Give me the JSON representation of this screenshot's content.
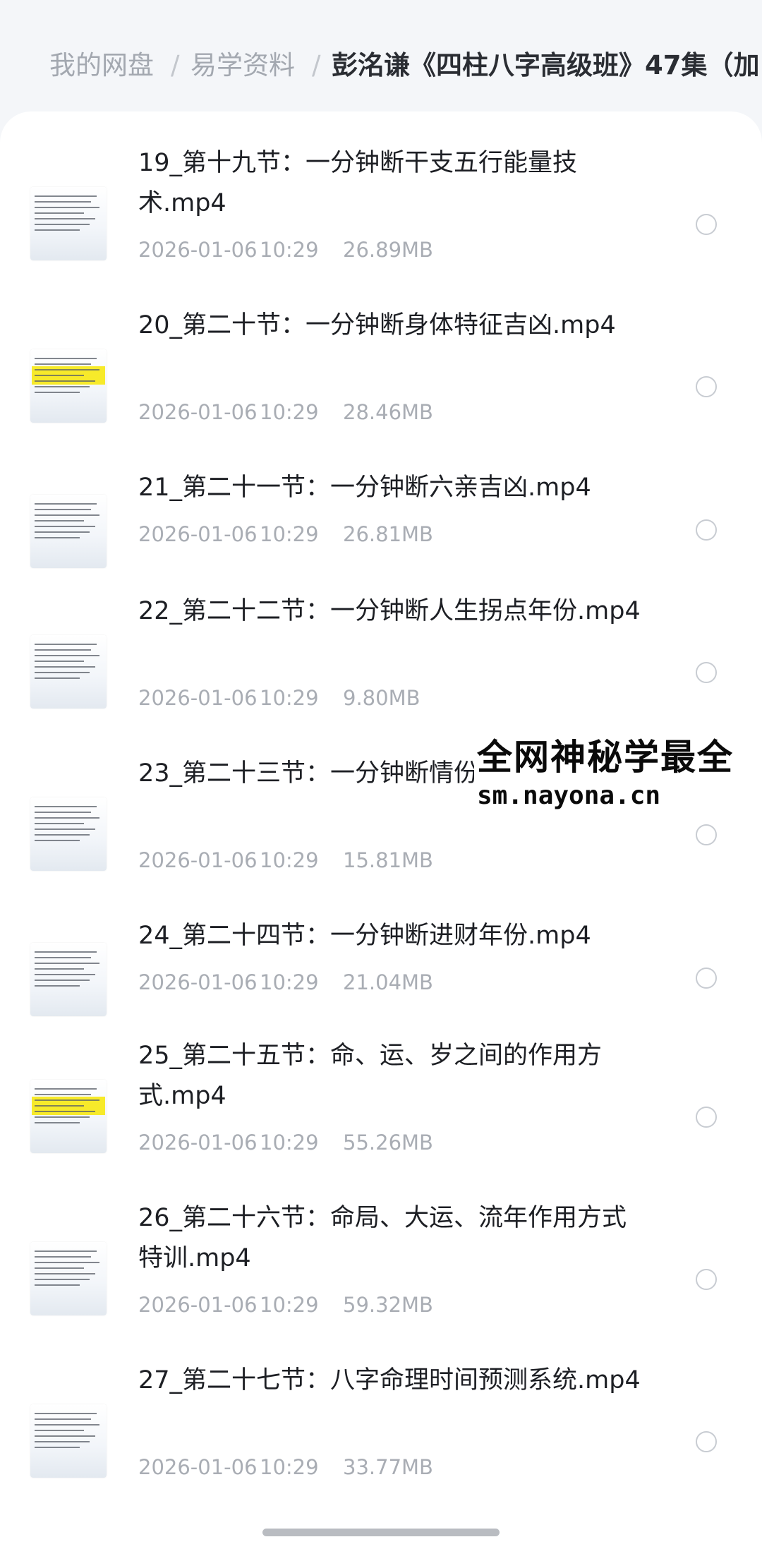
{
  "breadcrumb": {
    "root": "我的网盘",
    "parent": "易学资料",
    "current": "彭洺谦《四柱八字高级班》47集（加",
    "separator": "/"
  },
  "files": [
    {
      "name": "19_第十九节：一分钟断干支五行能量技术.mp4",
      "date": "2026-01-06",
      "time": "10:29",
      "size": "26.89MB",
      "thumb_highlight": false
    },
    {
      "name": "20_第二十节：一分钟断身体特征吉凶.mp4",
      "date": "2026-01-06",
      "time": "10:29",
      "size": "28.46MB",
      "thumb_highlight": true
    },
    {
      "name": "21_第二十一节：一分钟断六亲吉凶.mp4",
      "date": "2026-01-06",
      "time": "10:29",
      "size": "26.81MB",
      "thumb_highlight": false
    },
    {
      "name": "22_第二十二节：一分钟断人生拐点年份.mp4",
      "date": "2026-01-06",
      "time": "10:29",
      "size": "9.80MB",
      "thumb_highlight": false
    },
    {
      "name": "23_第二十三节：一分钟断情份.mp4",
      "date": "2026-01-06",
      "time": "10:29",
      "size": "15.81MB",
      "thumb_highlight": false
    },
    {
      "name": "24_第二十四节：一分钟断进财年份.mp4",
      "date": "2026-01-06",
      "time": "10:29",
      "size": "21.04MB",
      "thumb_highlight": false
    },
    {
      "name": "25_第二十五节：命、运、岁之间的作用方式.mp4",
      "date": "2026-01-06",
      "time": "10:29",
      "size": "55.26MB",
      "thumb_highlight": true
    },
    {
      "name": "26_第二十六节：命局、大运、流年作用方式特训.mp4",
      "date": "2026-01-06",
      "time": "10:29",
      "size": "59.32MB",
      "thumb_highlight": false
    },
    {
      "name": "27_第二十七节：八字命理时间预测系统.mp4",
      "date": "2026-01-06",
      "time": "10:29",
      "size": "33.77MB",
      "thumb_highlight": false
    }
  ],
  "watermark": {
    "line1": "全网神秘学最全",
    "line2": "sm.nayona.cn"
  },
  "icons": {
    "thumbnail": "video-thumbnail-icon",
    "select": "radio-circle-icon"
  },
  "colors": {
    "text_primary": "#1d1f24",
    "text_secondary": "#a9adb4",
    "breadcrumb_muted": "#a3a8b0",
    "thumbnail_highlight": "#f7ea2a"
  }
}
